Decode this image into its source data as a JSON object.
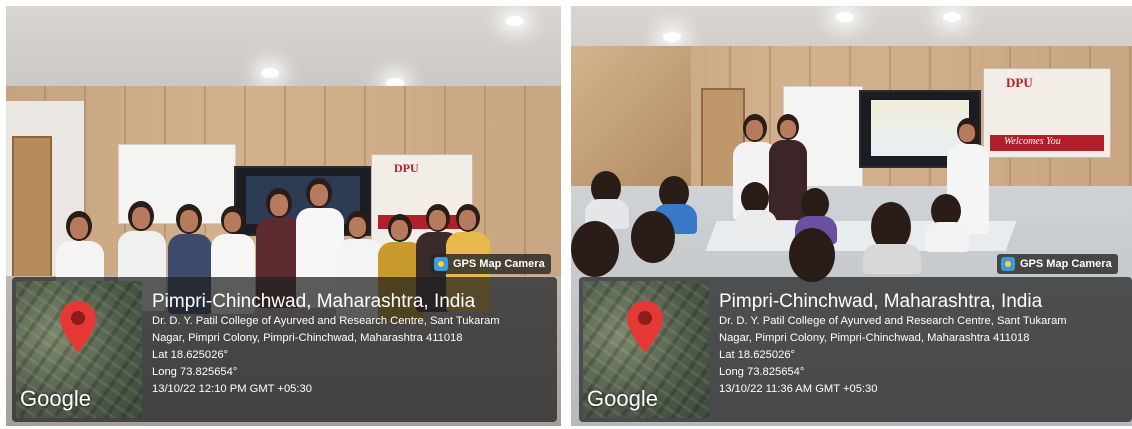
{
  "photos": [
    {
      "banner_logo": "DPU",
      "gps": {
        "app_label": "GPS Map Camera",
        "map_logo": "Google",
        "city": "Pimpri-Chinchwad, Maharashtra, India",
        "address_line1": "Dr. D. Y. Patil College of Ayurved and Research Centre, Sant Tukaram",
        "address_line2": "Nagar, Pimpri Colony, Pimpri-Chinchwad, Maharashtra 411018",
        "lat": "Lat 18.625026°",
        "long": "Long 73.825654°",
        "datetime": "13/10/22 12:10 PM GMT +05:30"
      }
    },
    {
      "banner_logo": "DPU",
      "banner_welcome": "Welcomes You",
      "gps": {
        "app_label": "GPS Map Camera",
        "map_logo": "Google",
        "city": "Pimpri-Chinchwad, Maharashtra, India",
        "address_line1": "Dr. D. Y. Patil College of Ayurved and Research Centre, Sant Tukaram",
        "address_line2": "Nagar, Pimpri Colony, Pimpri-Chinchwad, Maharashtra 411018",
        "lat": "Lat 18.625026°",
        "long": "Long 73.825654°",
        "datetime": "13/10/22 11:36 AM GMT +05:30"
      }
    }
  ],
  "colors": {
    "pin_red": "#e53935",
    "banner_red": "#b21e2a",
    "overlay_bg": "#1e1e1e"
  }
}
